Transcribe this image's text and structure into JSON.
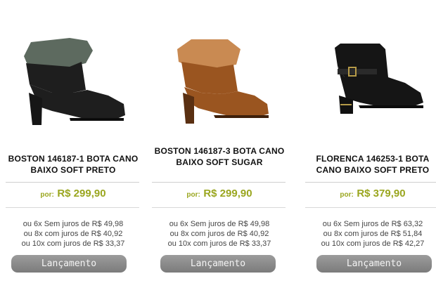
{
  "products": [
    {
      "name": "BOSTON 146187-1 BOTA CANO BAIXO SOFT PRETO",
      "price_prefix": "por:",
      "price": "R$ 299,90",
      "installments": [
        "ou 6x Sem juros de R$ 49,98",
        "ou 8x com juros de R$ 40,92",
        "ou 10x com juros de R$ 33,37"
      ],
      "button": "Lançamento",
      "shoe_color": "#1e1e1e",
      "cuff_color": "#5d6a5f"
    },
    {
      "name": "BOSTON 146187-3 BOTA CANO BAIXO SOFT SUGAR",
      "price_prefix": "por:",
      "price": "R$ 299,90",
      "installments": [
        "ou 6x Sem juros de R$ 49,98",
        "ou 8x com juros de R$ 40,92",
        "ou 10x com juros de R$ 33,37"
      ],
      "button": "Lançamento",
      "shoe_color": "#9a5520",
      "cuff_color": "#c98a52"
    },
    {
      "name": "FLORENCA 146253-1 BOTA CANO BAIXO SOFT PRETO",
      "price_prefix": "por:",
      "price": "R$ 379,90",
      "installments": [
        "ou 6x Sem juros de R$ 63,32",
        "ou 8x com juros de R$ 51,84",
        "ou 10x com juros de R$ 42,27"
      ],
      "button": "Lançamento",
      "shoe_color": "#151515",
      "cuff_color": "#2a2a2a"
    }
  ],
  "colors": {
    "price_accent": "#9aa61f",
    "button_bg": "#8a8a8a"
  }
}
